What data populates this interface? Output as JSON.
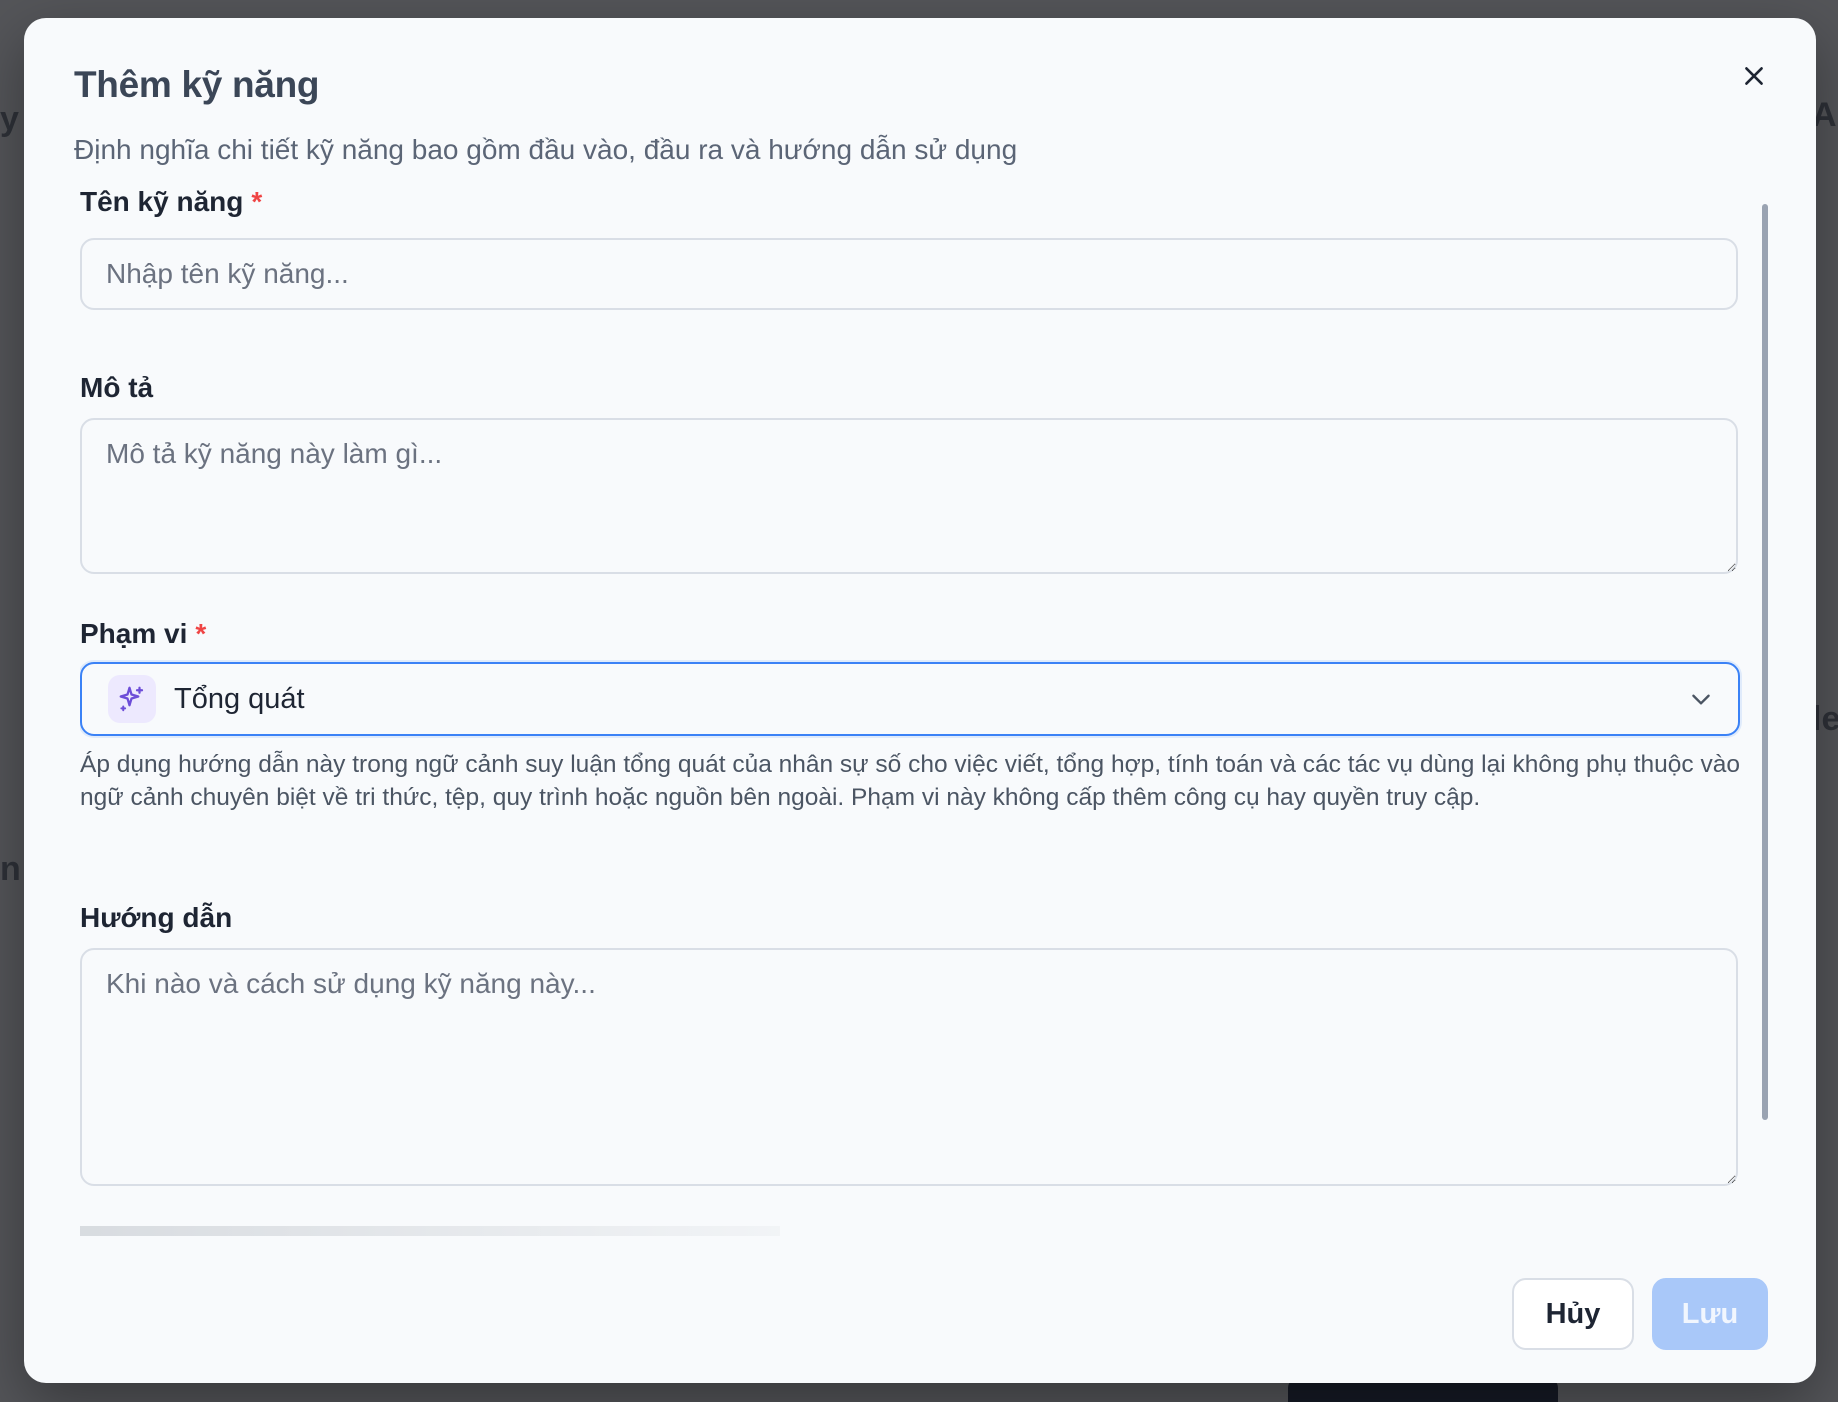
{
  "modal": {
    "title": "Thêm kỹ năng",
    "subtitle": "Định nghĩa chi tiết kỹ năng bao gồm đầu vào, đầu ra và hướng dẫn sử dụng",
    "close_icon": "close-icon"
  },
  "form": {
    "name": {
      "label": "Tên kỹ năng",
      "required_mark": "*",
      "placeholder": "Nhập tên kỹ năng..."
    },
    "description": {
      "label": "Mô tả",
      "placeholder": "Mô tả kỹ năng này làm gì..."
    },
    "scope": {
      "label": "Phạm vi",
      "required_mark": "*",
      "selected": "Tổng quát",
      "icon": "sparkles-icon",
      "helper": "Áp dụng hướng dẫn này trong ngữ cảnh suy luận tổng quát của nhân sự số cho việc viết, tổng hợp, tính toán và các tác vụ dùng lại không phụ thuộc vào ngữ cảnh chuyên biệt về tri thức, tệp, quy trình hoặc nguồn bên ngoài. Phạm vi này không cấp thêm công cụ hay quyền truy cập."
    },
    "instructions": {
      "label": "Hướng dẫn",
      "placeholder": "Khi nào và cách sử dụng kỹ năng này..."
    }
  },
  "footer": {
    "cancel_label": "Hủy",
    "save_label": "Lưu"
  },
  "colors": {
    "accent": "#3b82f6",
    "required": "#ef4444",
    "save_disabled": "#a9c8f9",
    "scope_icon_bg": "#ede9fe",
    "scope_icon": "#6d4dd8"
  }
}
